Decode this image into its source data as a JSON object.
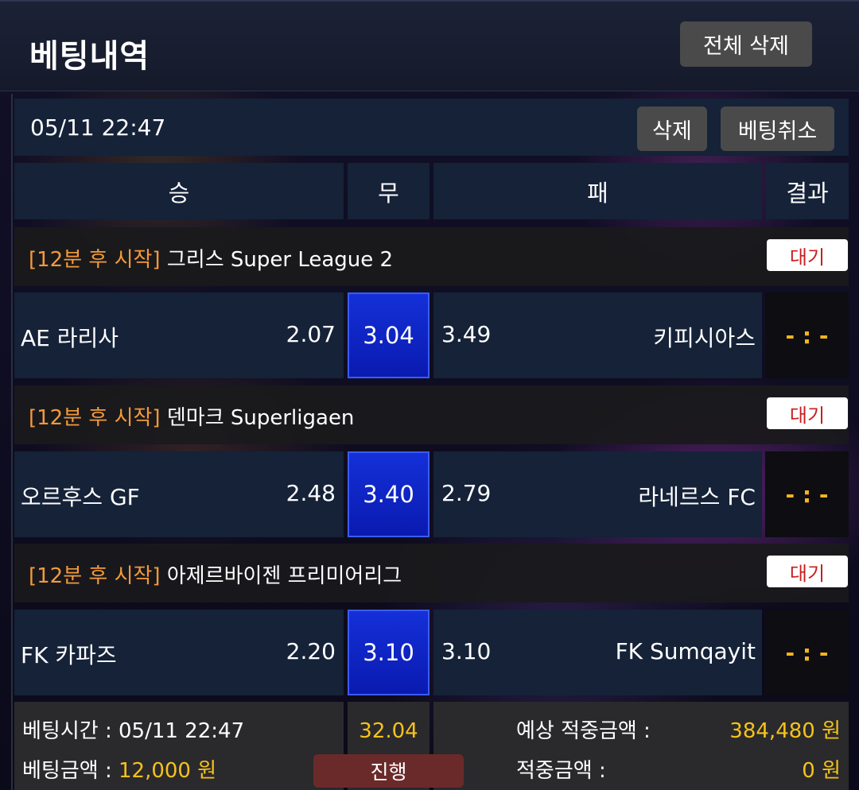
{
  "header": {
    "title": "베팅내역",
    "delete_all_label": "전체 삭제"
  },
  "bet": {
    "datetime": "05/11 22:47",
    "delete_label": "삭제",
    "cancel_label": "베팅취소"
  },
  "columns": {
    "win": "승",
    "draw": "무",
    "lose": "패",
    "result": "결과"
  },
  "matches": [
    {
      "start_tag": "[12분 후 시작]",
      "league": " 그리스 Super League 2",
      "status": "대기",
      "home": "AE 라리사",
      "home_odds": "2.07",
      "draw_odds": "3.04",
      "away_odds": "3.49",
      "away": "키피시아스",
      "result": "- : -"
    },
    {
      "start_tag": "[12분 후 시작]",
      "league": " 덴마크 Superligaen",
      "status": "대기",
      "home": "오르후스 GF",
      "home_odds": "2.48",
      "draw_odds": "3.40",
      "away_odds": "2.79",
      "away": "라네르스 FC",
      "result": "- : -"
    },
    {
      "start_tag": "[12분 후 시작]",
      "league": " 아제르바이젠 프리미어리그",
      "status": "대기",
      "home": "FK 카파즈",
      "home_odds": "2.20",
      "draw_odds": "3.10",
      "away_odds": "3.10",
      "away": "FK Sumqayit",
      "result": "- : -"
    }
  ],
  "summary": {
    "bet_time_label": "베팅시간 : ",
    "bet_time_value": "05/11 22:47",
    "bet_amount_label": "베팅금액 : ",
    "bet_amount_value": "12,000 원",
    "total_odds": "32.04",
    "progress_label": "진행",
    "expected_label": "예상 적중금액 :",
    "expected_value": "384,480 원",
    "win_label": "적중금액 :",
    "win_value": "0 원"
  },
  "colors": {
    "accent_orange": "#f39a3a",
    "status_red": "#c81e1e",
    "draw_blue": "#1430d8",
    "yellow": "#f5c21b"
  }
}
